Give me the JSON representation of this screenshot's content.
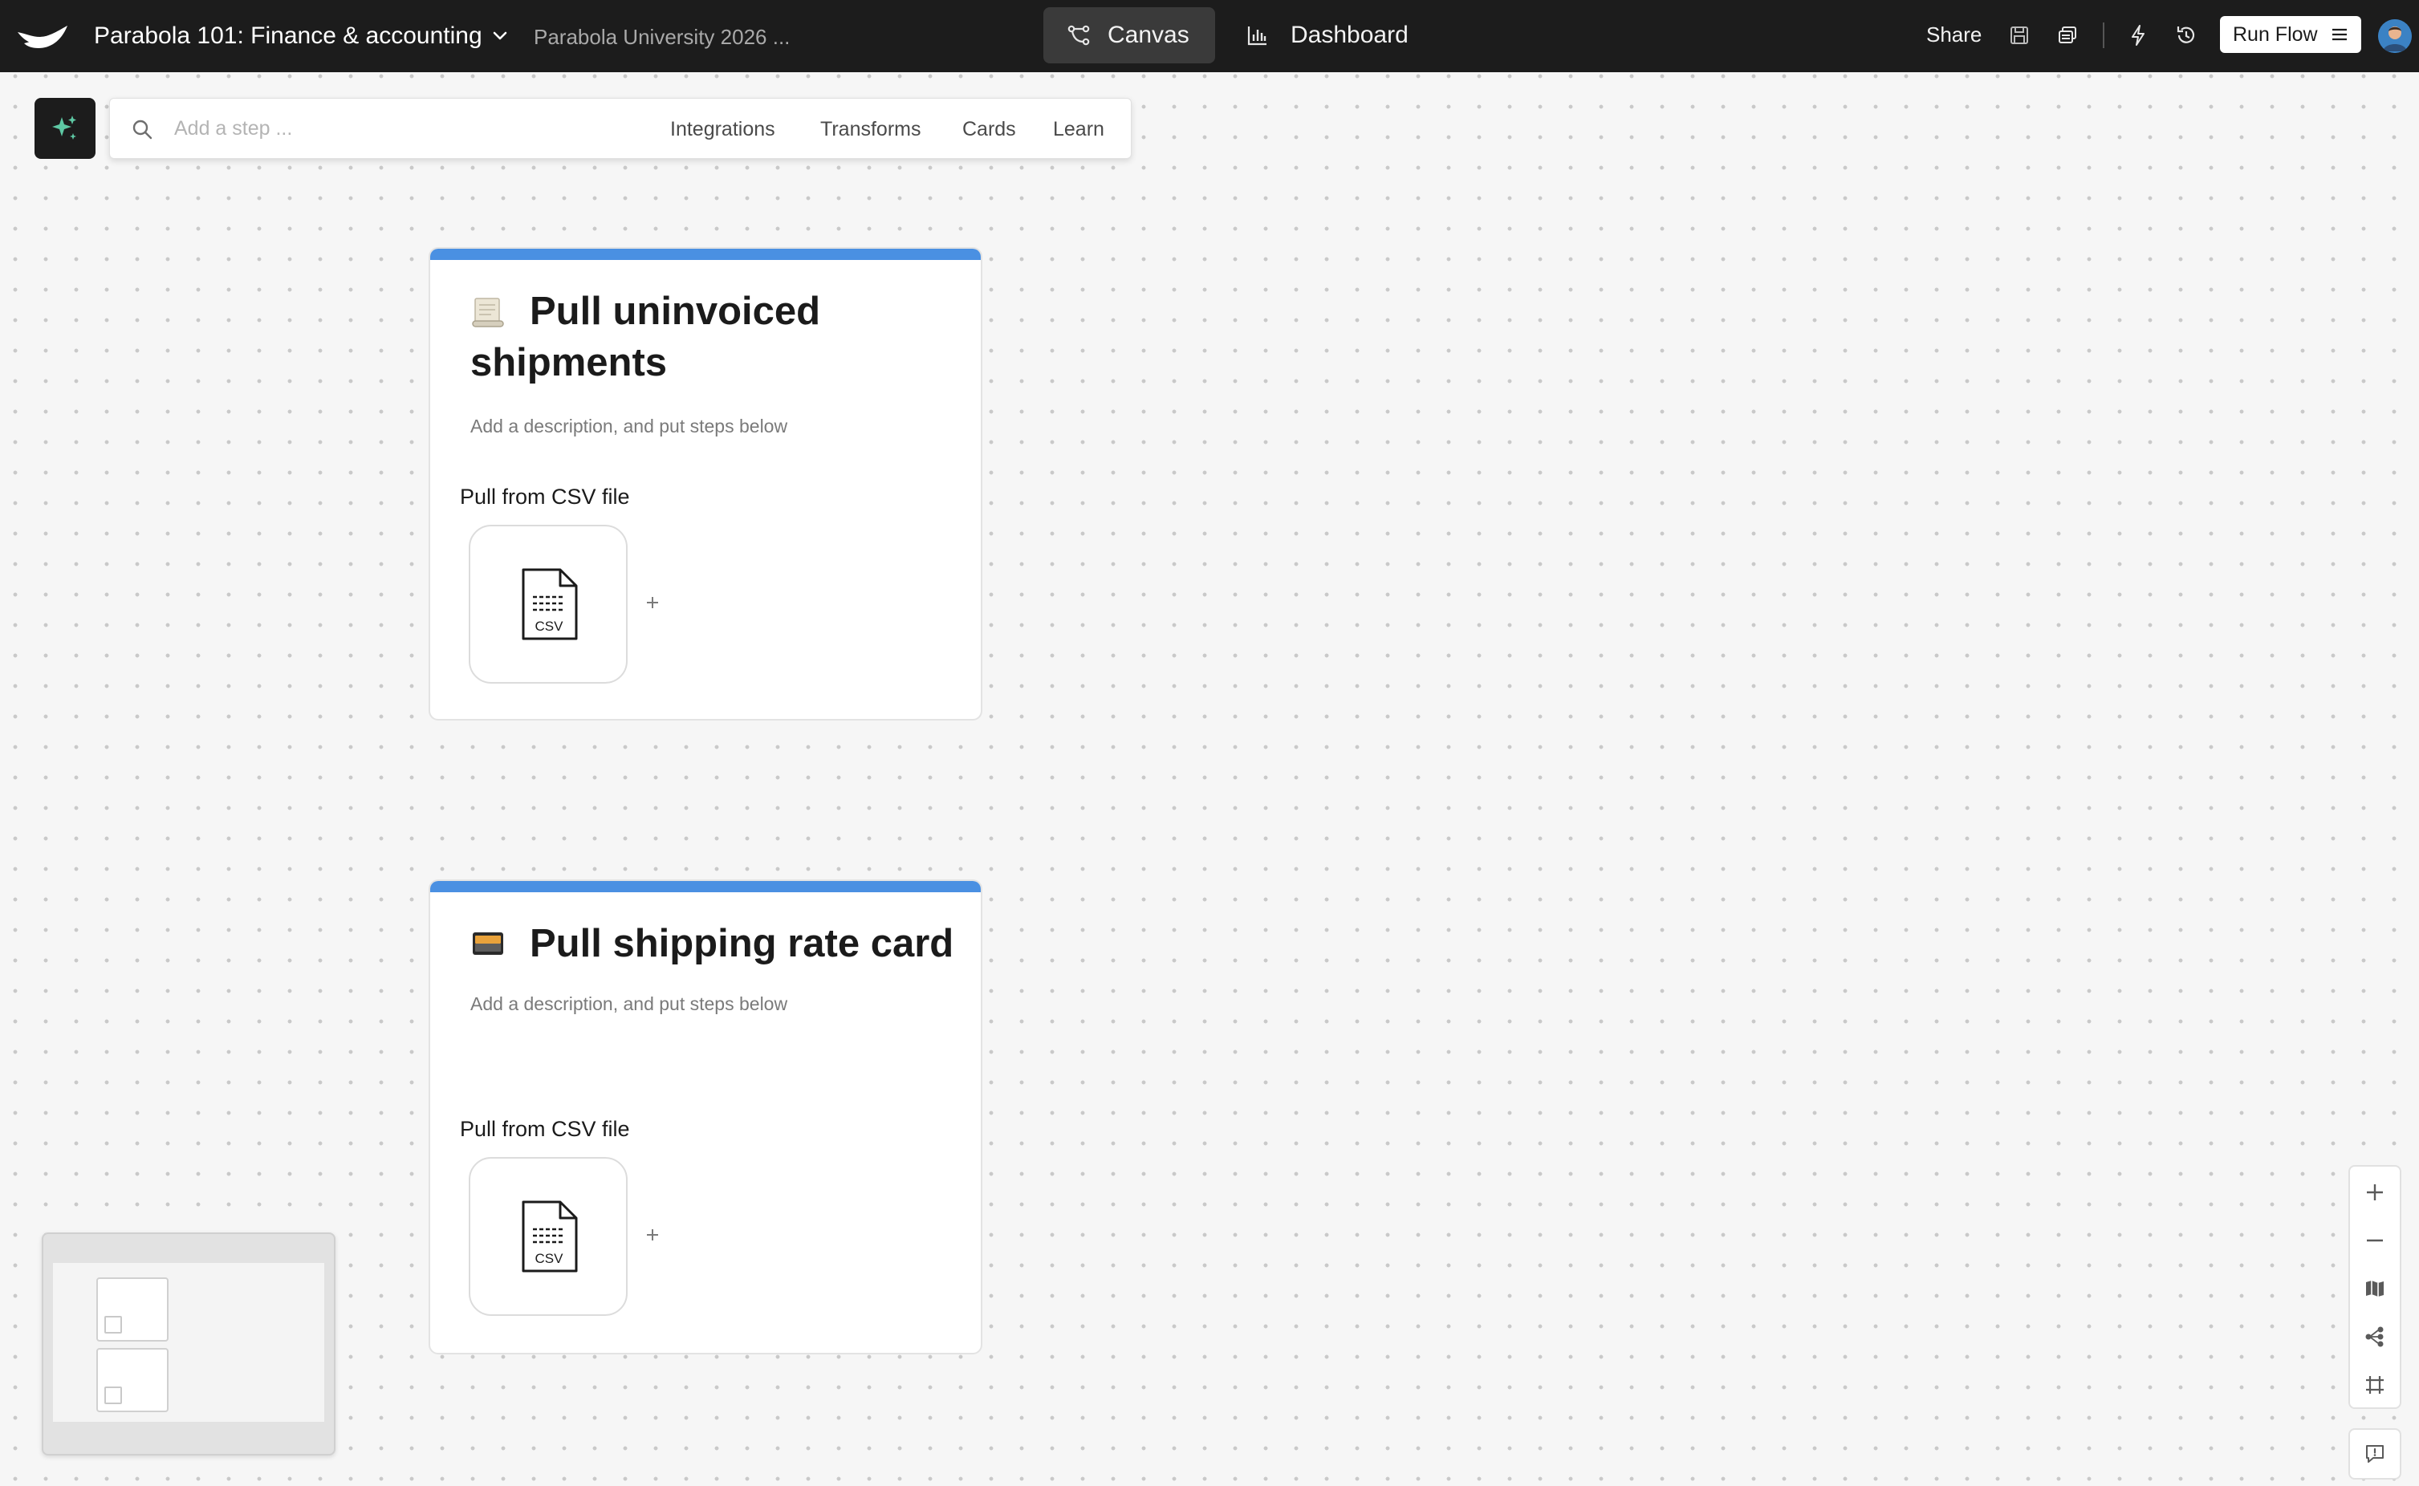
{
  "header": {
    "flow_title": "Parabola 101: Finance & accounting",
    "org_name": "Parabola University 2026 ...",
    "tabs": [
      {
        "label": "Canvas",
        "icon": "flow-icon",
        "active": true
      },
      {
        "label": "Dashboard",
        "icon": "bar-chart-icon",
        "active": false
      }
    ],
    "share_label": "Share",
    "run_flow_label": "Run Flow"
  },
  "search": {
    "placeholder": "Add a step ...",
    "value": "",
    "nav": [
      "Integrations",
      "Transforms",
      "Cards",
      "Learn"
    ]
  },
  "cards": [
    {
      "emoji": "scroll",
      "title": "Pull uninvoiced shipments",
      "description": "Add a description, and put steps below",
      "step": {
        "label": "Pull from CSV file",
        "file_type": "CSV"
      }
    },
    {
      "emoji": "card-index",
      "title": "Pull shipping rate card",
      "description": "Add a description, and put steps below",
      "step": {
        "label": "Pull from CSV file",
        "file_type": "CSV"
      }
    }
  ],
  "colors": {
    "topbar": "#1c1c1c",
    "accent": "#4a90e2",
    "canvas": "#f6f6f6",
    "ai_sparkle": "#5ec8a4"
  }
}
